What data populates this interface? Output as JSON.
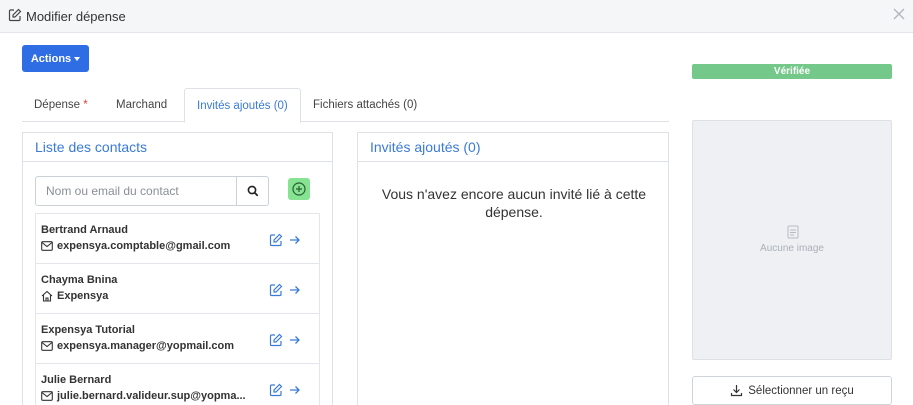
{
  "modal": {
    "title": "Modifier dépense"
  },
  "actions": {
    "label": "Actions"
  },
  "status": {
    "label": "Vérifiée",
    "color": "#74c98a"
  },
  "tabs": [
    {
      "label": "Dépense",
      "required_mark": "*"
    },
    {
      "label": "Marchand"
    },
    {
      "label": "Invités ajoutés (0)",
      "active": true
    },
    {
      "label": "Fichiers attachés (0)"
    }
  ],
  "contacts": {
    "title": "Liste des contacts",
    "search_placeholder": "Nom ou email du contact",
    "items": [
      {
        "name": "Bertrand Arnaud",
        "detail": "expensya.comptable@gmail.com",
        "detail_icon": "mail-icon"
      },
      {
        "name": "Chayma Bnina",
        "detail": "Expensya",
        "detail_icon": "home-icon"
      },
      {
        "name": "Expensya Tutorial",
        "detail": "expensya.manager@yopmail.com",
        "detail_icon": "mail-icon"
      },
      {
        "name": "Julie Bernard",
        "detail": "julie.bernard.valideur.sup@yopma...",
        "detail_icon": "mail-icon"
      }
    ]
  },
  "guests": {
    "title": "Invités ajoutés (0)",
    "empty_message": "Vous n'avez encore aucun invité lié à cette dépense."
  },
  "receipt": {
    "no_image": "Aucune image",
    "select_label": "Sélectionner un reçu"
  },
  "colors": {
    "accent": "#2f6de5",
    "link": "#3a7bd5",
    "add": "#86e391"
  }
}
